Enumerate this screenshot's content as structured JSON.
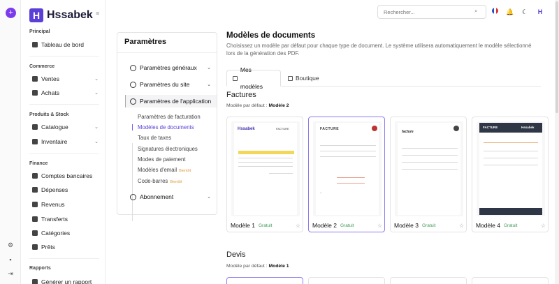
{
  "app": {
    "brand": "Hssabek"
  },
  "search": {
    "placeholder": "Rechercher..."
  },
  "sidebar": {
    "sections": [
      {
        "title": "Principal",
        "items": [
          "Tableau de bord"
        ]
      },
      {
        "title": "Commerce",
        "items": [
          "Ventes",
          "Achats"
        ]
      },
      {
        "title": "Produits & Stock",
        "items": [
          "Catalogue",
          "Inventaire"
        ]
      },
      {
        "title": "Finance",
        "items": [
          "Comptes bancaires",
          "Dépenses",
          "Revenus",
          "Transferts",
          "Catégories",
          "Prêts"
        ]
      },
      {
        "title": "Rapports",
        "items": [
          "Générer un rapport"
        ]
      }
    ]
  },
  "settings": {
    "title": "Paramètres",
    "groups": [
      "Paramètres généraux",
      "Paramètres du site",
      "Paramètres de l'application",
      "Abonnement"
    ],
    "subitems": [
      "Paramètres de facturation",
      "Modèles de documents",
      "Taux de taxes",
      "Signatures électroniques",
      "Modes de paiement",
      "Modèles d'email",
      "Code-barres"
    ],
    "beta": "Bientôt"
  },
  "main": {
    "title": "Modèles de documents",
    "description": "Choisissez un modèle par défaut pour chaque type de document. Le système utilisera automatiquement le modèle sélectionné lors de la génération des PDF.",
    "tabs": [
      "Mes modèles",
      "Boutique"
    ],
    "sections": [
      {
        "name": "Factures",
        "default_label": "Modèle par défaut :",
        "default_value": "Modèle 2"
      },
      {
        "name": "Devis",
        "default_label": "Modèle par défaut :",
        "default_value": "Modèle 1"
      }
    ],
    "cards": [
      {
        "name": "Modèle 1",
        "tag": "Gratuit"
      },
      {
        "name": "Modèle 2",
        "tag": "Gratuit"
      },
      {
        "name": "Modèle 3",
        "tag": "Gratuit"
      },
      {
        "name": "Modèle 4",
        "tag": "Gratuit"
      }
    ],
    "doc_headers": [
      "FACTURE",
      "FACTURE",
      "facture",
      "FACTURE"
    ],
    "accent": "#5b3fd6"
  }
}
